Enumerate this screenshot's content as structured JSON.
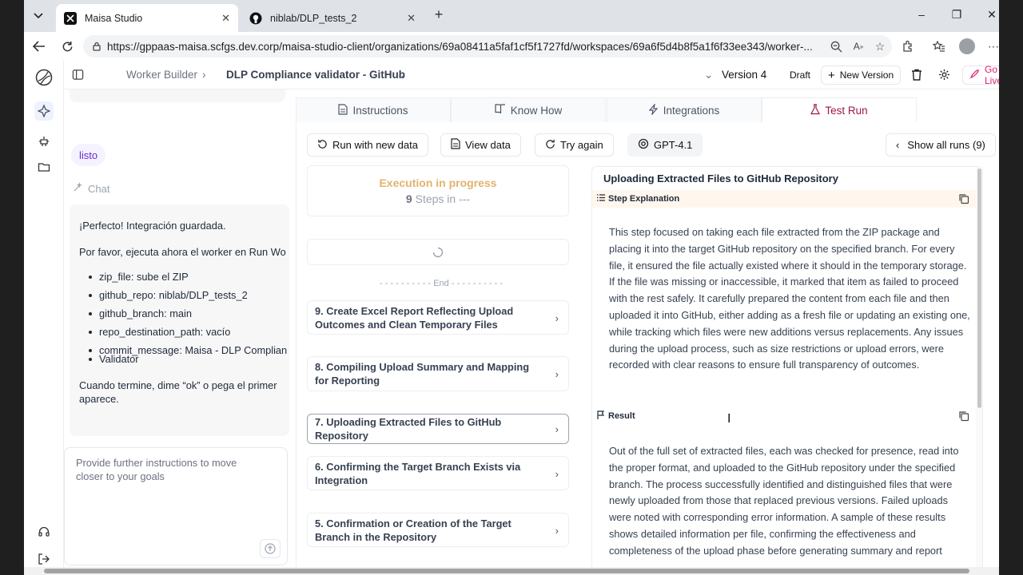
{
  "browser": {
    "tabs": [
      {
        "title": "Maisa Studio",
        "active": true
      },
      {
        "title": "niblab/DLP_tests_2",
        "active": false
      }
    ],
    "url": "https://gppaas-maisa.scfgs.dev.corp/maisa-studio-client/organizations/69a08411a5faf1cf5f1727fd/workspaces/69a6f5d4b8f5a1f6f33ee343/worker-..."
  },
  "topbar": {
    "breadcrumb_root": "Worker Builder",
    "worker_name": "DLP Compliance validator - GitHub",
    "version": "Version 4",
    "draft_label": "Draft",
    "new_version_label": "New Version",
    "go_live_label": "Go Live"
  },
  "chat": {
    "user_message": "listo",
    "section_label": "Chat",
    "intro": "¡Perfecto! Integración guardada.",
    "request": "Por favor, ejecuta ahora el worker en Run Wo",
    "items": [
      "zip_file: sube el ZIP",
      "github_repo: niblab/DLP_tests_2",
      "github_branch: main",
      "repo_destination_path: vacío",
      "commit_message: Maisa - DLP Complian",
      "Validator"
    ],
    "outro_1": "Cuando termine, dime “ok” o pega el primer",
    "outro_2": "aparece.",
    "input_placeholder_1": "Provide further instructions to move",
    "input_placeholder_2": "closer to your goals"
  },
  "main_tabs": [
    {
      "label": "Instructions",
      "icon": "document-icon"
    },
    {
      "label": "Know How",
      "icon": "book-icon"
    },
    {
      "label": "Integrations",
      "icon": "bolt-icon"
    },
    {
      "label": "Test Run",
      "icon": "flask-icon"
    }
  ],
  "actions": {
    "run_new": "Run with new data",
    "view_data": "View data",
    "try_again": "Try again",
    "model": "GPT-4.1",
    "show_runs": "Show all runs (9)"
  },
  "execution": {
    "status": "Execution in progress",
    "steps_count": "9",
    "steps_suffix": "Steps in ---",
    "end_label": "- - - - - - - - - -    End    - - - - - - - - - -"
  },
  "steps": [
    {
      "label": "9. Create Excel Report Reflecting Upload Outcomes and Clean Temporary Files"
    },
    {
      "label": "8. Compiling Upload Summary and Mapping for Reporting"
    },
    {
      "label": "7. Uploading Extracted Files to GitHub Repository"
    },
    {
      "label": "6. Confirming the Target Branch Exists via Integration"
    },
    {
      "label": "5. Confirmation or Creation of the Target Branch in the Repository"
    }
  ],
  "detail": {
    "title": "Uploading Extracted Files to GitHub Repository",
    "explanation_label": "Step Explanation",
    "explanation": "This step focused on taking each file extracted from the ZIP package and placing it into the target GitHub repository on the specified branch. For every file, it ensured the file actually existed where it should in the temporary storage. If the file was missing or inaccessible, it marked that item as failed to proceed with the rest safely. It carefully prepared the content from each file and then uploaded it into GitHub, either adding as a fresh file or updating an existing one, while tracking which files were new additions versus replacements. Any issues during the upload process, such as size restrictions or upload errors, were recorded with clear reasons to ensure full transparency of outcomes.",
    "result_label": "Result",
    "result": "Out of the full set of extracted files, each was checked for presence, read into the proper format, and uploaded to the GitHub repository under the specified branch. The process successfully identified and distinguished files that were newly uploaded from those that replaced previous versions. Failed uploads were noted with corresponding error information. A sample of these results shows detailed information per file, confirming the effectiveness and completeness of the upload phase before generating summary and report"
  },
  "colors": {
    "accent": "#9d174d",
    "exec_status": "#e2b36d",
    "go_live": "#e11d74"
  }
}
